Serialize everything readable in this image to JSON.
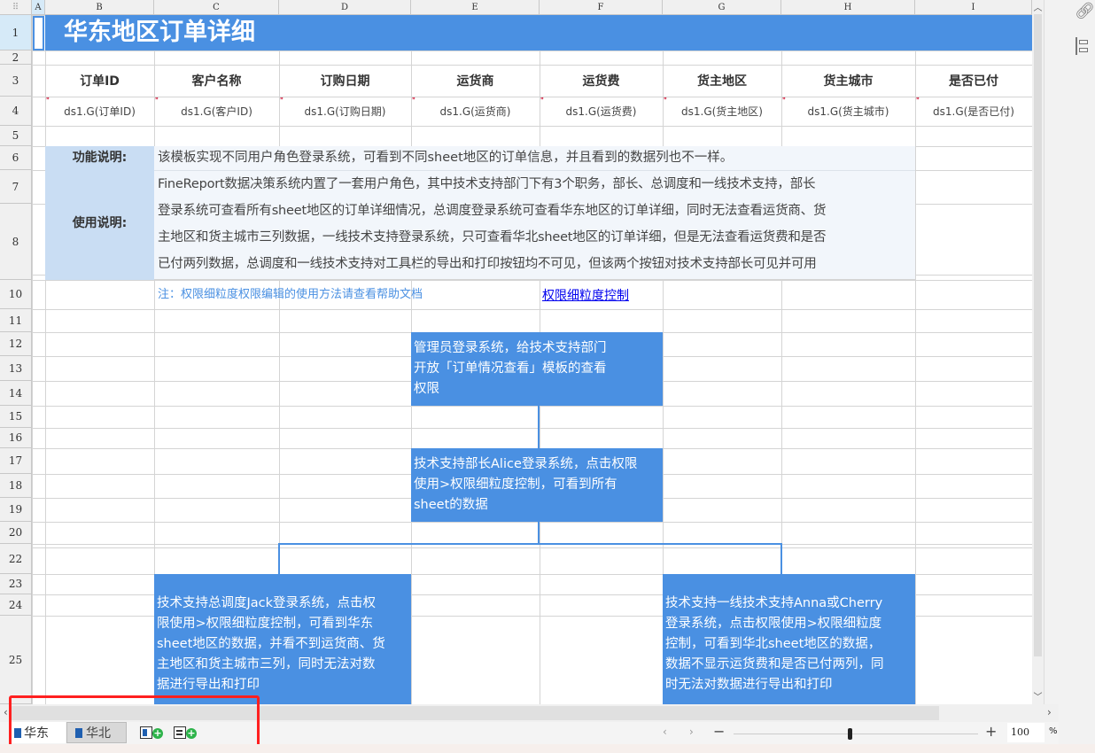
{
  "sheet": {
    "columns": [
      "A",
      "B",
      "C",
      "D",
      "E",
      "F",
      "G",
      "H",
      "I"
    ],
    "rows": [
      "1",
      "2",
      "3",
      "4",
      "5",
      "6",
      "7",
      "8",
      "10",
      "11",
      "12",
      "13",
      "14",
      "15",
      "16",
      "17",
      "18",
      "19",
      "20",
      "22",
      "23",
      "24",
      "25"
    ],
    "title": "华东地区订单详细",
    "headers": [
      "订单ID",
      "客户名称",
      "订购日期",
      "运货商",
      "运货费",
      "货主地区",
      "货主城市",
      "是否已付"
    ],
    "fields": [
      "ds1.G(订单ID)",
      "ds1.G(客户ID)",
      "ds1.G(订购日期)",
      "ds1.G(运货商)",
      "ds1.G(运货费)",
      "ds1.G(货主地区)",
      "ds1.G(货主城市)",
      "ds1.G(是否已付)"
    ],
    "func_label": "功能说明:",
    "func_text": "该模板实现不同用户角色登录系统，可看到不同sheet地区的订单信息，并且看到的数据列也不一样。",
    "usage_label": "使用说明:",
    "usage_text": "FineReport数据决策系统内置了一套用户角色，其中技术支持部门下有3个职务，部长、总调度和一线技术支持，部长\n登录系统可查看所有sheet地区的订单详细情况，总调度登录系统可查看华东地区的订单详细，同时无法查看运货商、货\n主地区和货主城市三列数据，一线技术支持登录系统，只可查看华北sheet地区的订单详细，但是无法查看运货费和是否\n已付两列数据，总调度和一线技术支持对工具栏的导出和打印按钮均不可见，但该两个按钮对技术支持部长可见并可用",
    "note": "注：权限细粒度权限编辑的使用方法请查看帮助文档",
    "link": "权限细粒度控制",
    "flow": {
      "step1": "管理员登录系统，给技术支持部门\n开放「订单情况查看」模板的查看\n权限",
      "step2": "技术支持部长Alice登录系统，点击权限\n使用>权限细粒度控制，可看到所有\nsheet的数据",
      "step3a": "技术支持总调度Jack登录系统，点击权\n限使用>权限细粒度控制，可看到华东\nsheet地区的数据，并看不到运货商、货\n主地区和货主城市三列，同时无法对数\n据进行导出和打印",
      "step3b": "技术支持一线技术支持Anna或Cherry\n登录系统，点击权限使用>权限细粒度\n控制，可看到华北sheet地区的数据，\n数据不显示运货费和是否已付两列，同\n时无法对数据进行导出和打印"
    }
  },
  "tabs": [
    {
      "label": "华东",
      "active": true
    },
    {
      "label": "华北",
      "active": false
    }
  ],
  "zoom": {
    "value": "100",
    "unit": "%"
  },
  "colors": {
    "accent": "#4a90e2",
    "label_bg": "#c9ddf3",
    "text_bg": "#f2f6fb",
    "link": "#0000ee",
    "note": "#4a90e2",
    "highlight": "#ff2020"
  }
}
